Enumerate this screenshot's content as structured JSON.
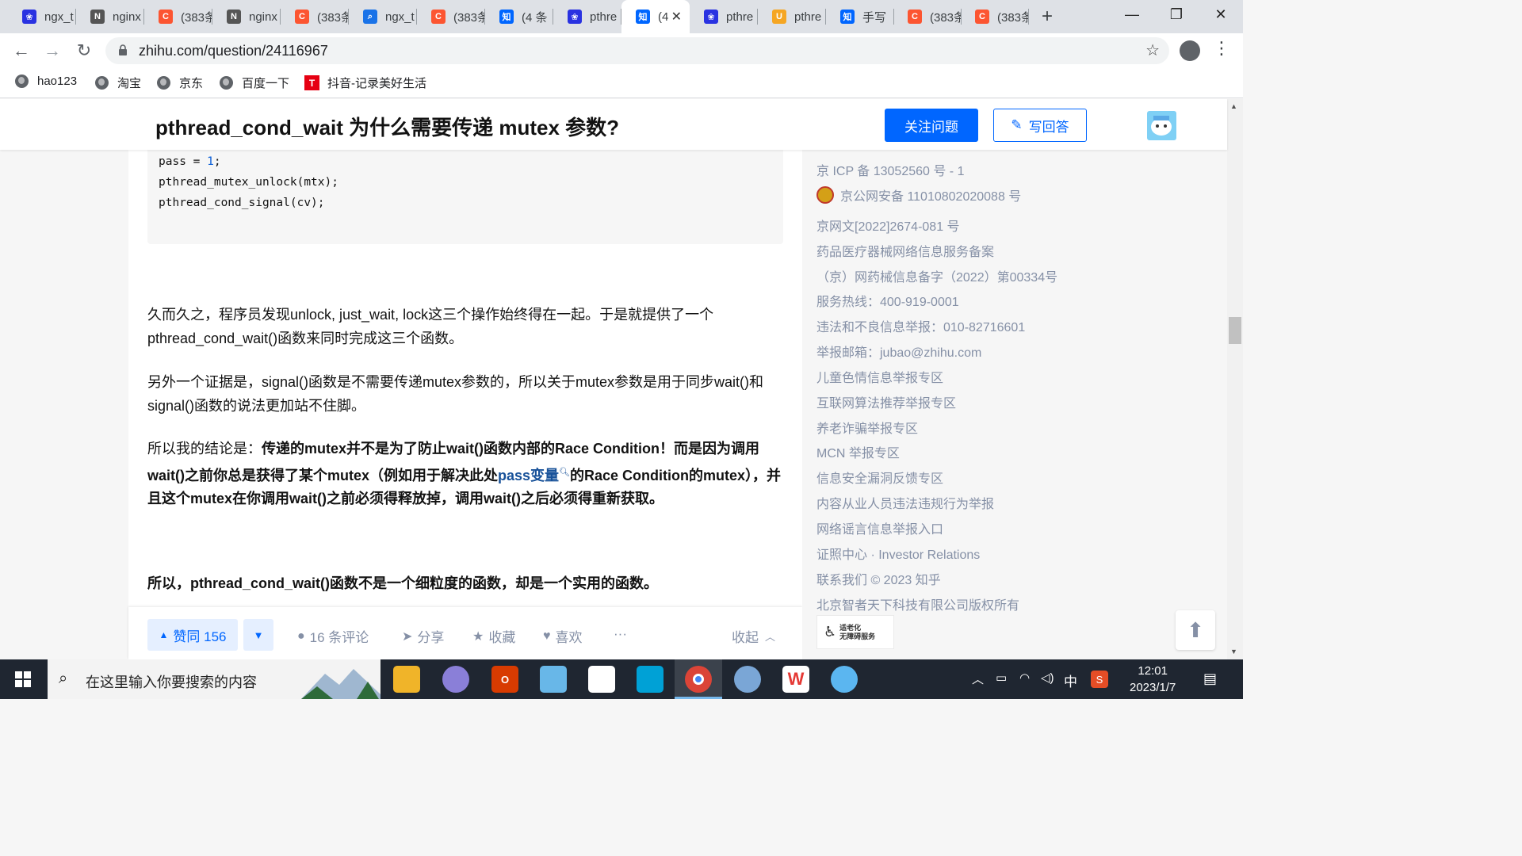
{
  "tabs": [
    {
      "title": "ngx_t",
      "favicon": "paw-icon",
      "color": "#2932e1"
    },
    {
      "title": "nginx",
      "favicon": "nginx-icon",
      "color": "#555555"
    },
    {
      "title": "(383条",
      "favicon": "c-icon",
      "color": "#fc5531"
    },
    {
      "title": "nginx",
      "favicon": "nginx-icon",
      "color": "#555555"
    },
    {
      "title": "(383条",
      "favicon": "c-icon",
      "color": "#fc5531"
    },
    {
      "title": "ngx_t",
      "favicon": "search-icon",
      "color": "#1a73e8"
    },
    {
      "title": "(383条",
      "favicon": "c-icon",
      "color": "#fc5531"
    },
    {
      "title": "(4 条",
      "favicon": "zhi-icon",
      "color": "#0066ff"
    },
    {
      "title": "pthre",
      "favicon": "paw-icon",
      "color": "#2932e1"
    },
    {
      "title": "(4",
      "favicon": "zhi-icon",
      "color": "#0066ff",
      "active": true
    },
    {
      "title": "pthre",
      "favicon": "paw-icon",
      "color": "#2932e1"
    },
    {
      "title": "pthre",
      "favicon": "u-icon",
      "color": "#f5a623"
    },
    {
      "title": "手写",
      "favicon": "zhi-icon",
      "color": "#0066ff"
    },
    {
      "title": "(383条",
      "favicon": "c-icon",
      "color": "#fc5531"
    },
    {
      "title": "(383条",
      "favicon": "c-icon",
      "color": "#fc5531"
    }
  ],
  "browser": {
    "url": "zhihu.com/question/24116967",
    "new_tab": "+",
    "tab_close": "✕"
  },
  "bookmarks": [
    {
      "label": "hao123"
    },
    {
      "label": "淘宝"
    },
    {
      "label": "京东"
    },
    {
      "label": "百度一下"
    },
    {
      "label": "抖音-记录美好生活"
    }
  ],
  "question": {
    "title": "pthread_cond_wait 为什么需要传递 mutex 参数?",
    "follow_label": "关注问题",
    "write_label": "写回答"
  },
  "code": {
    "line1_pre": "pass = ",
    "line1_num": "1",
    "line1_post": ";",
    "line2": "pthread_mutex_unlock(mtx);",
    "line3": "pthread_cond_signal(cv);"
  },
  "paragraphs": {
    "p1": "久而久之，程序员发现unlock, just_wait, lock这三个操作始终得在一起。于是就提供了一个pthread_cond_wait()函数来同时完成这三个函数。",
    "p2": "另外一个证据是，signal()函数是不需要传递mutex参数的，所以关于mutex参数是用于同步wait()和signal()函数的说法更加站不住脚。",
    "p3_lead": "所以我的结论是：",
    "p3_bold1": "传递的mutex并不是为了防止wait()函数内部的Race Condition！而是因为调用wait()之前你总是获得了某个mutex（例如用于解决此处",
    "p3_link": "pass变量",
    "p3_bold2": "的Race Condition的mutex），并且这个mutex在你调用wait()之前必须得释放掉，调用wait()之后必须得重新获取。",
    "p4": "所以，pthread_cond_wait()函数不是一个细粒度的函数，却是一个实用的函数。"
  },
  "actions": {
    "vote_label": "赞同 156",
    "comments": "16 条评论",
    "share": "分享",
    "favorite": "收藏",
    "like": "喜欢",
    "more": "···",
    "collapse": "收起"
  },
  "sidebar": {
    "lines": [
      "京 ICP 备 13052560 号 - 1",
      "京公网安备 11010802020088 号",
      "京网文[2022]2674-081 号",
      "药品医疗器械网络信息服务备案",
      "（京）网药械信息备字（2022）第00334号",
      "服务热线：400-919-0001",
      "违法和不良信息举报：010-82716601",
      "举报邮箱：jubao@zhihu.com",
      "儿童色情信息举报专区",
      "互联网算法推荐举报专区",
      "养老诈骗举报专区",
      "MCN 举报专区",
      "信息安全漏洞反馈专区",
      "内容从业人员违法违规行为举报",
      "网络谣言信息举报入口",
      "证照中心 · Investor Relations",
      "联系我们 © 2023 知乎",
      "北京智者天下科技有限公司版权所有"
    ],
    "elder_badge_line1": "适老化",
    "elder_badge_line2": "无障碍服务"
  },
  "taskbar": {
    "search_placeholder": "在这里输入你要搜索的内容",
    "ime": "中",
    "time": "12:01",
    "date": "2023/1/7"
  },
  "colors": {
    "accent": "#0066ff",
    "link": "#175199",
    "muted": "#8590a6"
  }
}
